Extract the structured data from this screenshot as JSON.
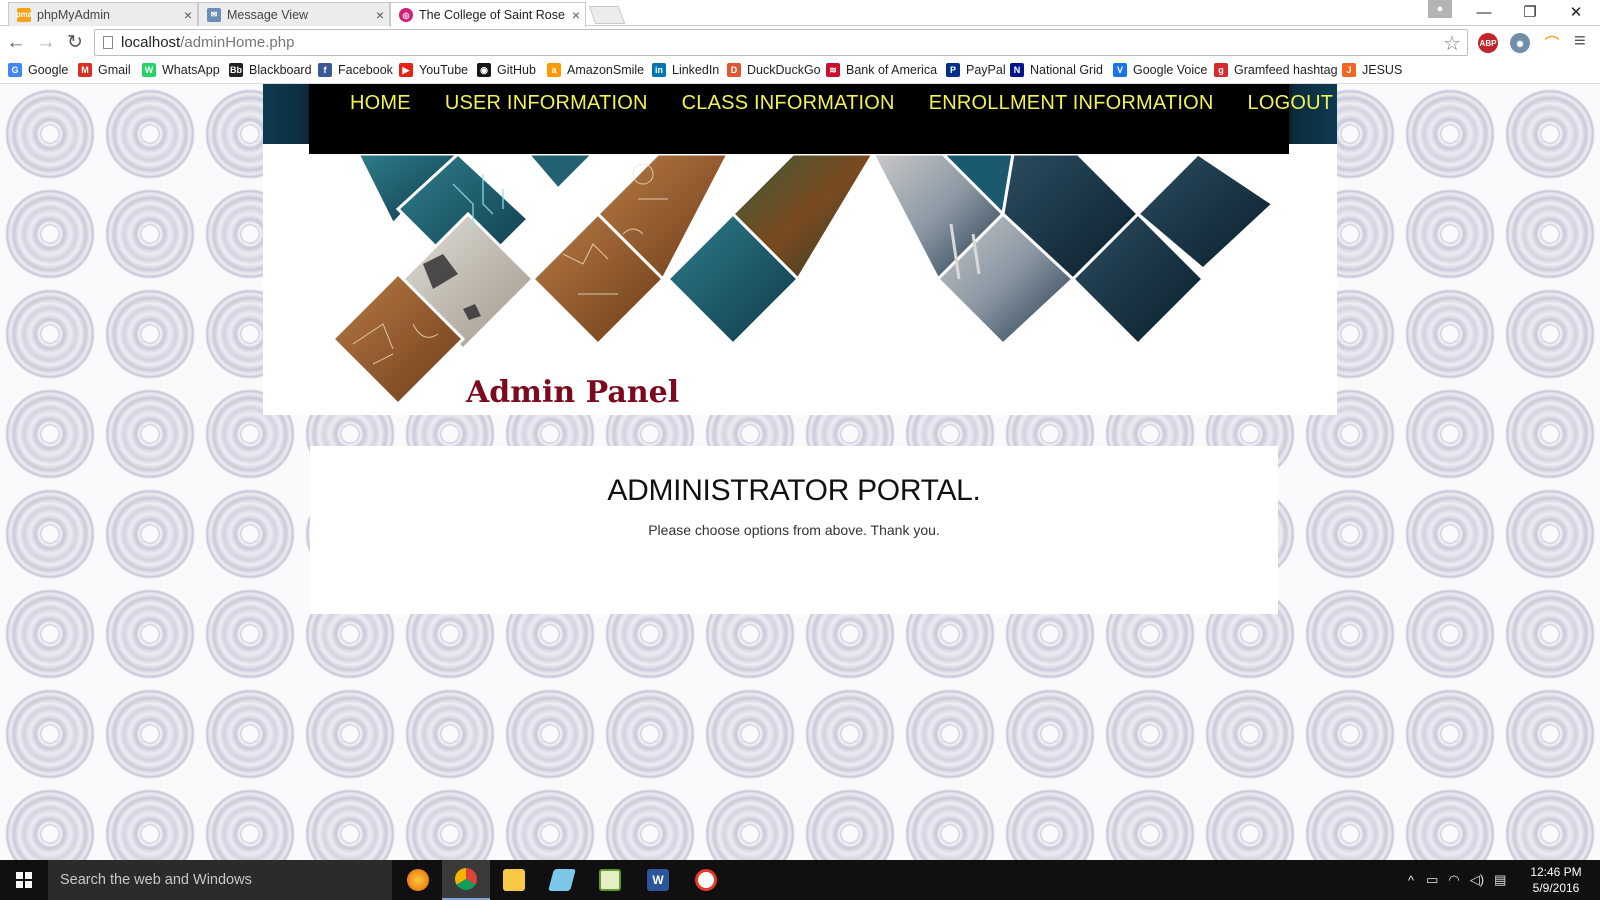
{
  "tabs": [
    {
      "title": "phpMyAdmin",
      "icon": "phpmyadmin-icon",
      "close": "×"
    },
    {
      "title": "Message View",
      "icon": "message-icon",
      "close": "×"
    },
    {
      "title": "The College of Saint Rose",
      "icon": "saint-rose-icon",
      "close": "×"
    }
  ],
  "window_controls": {
    "minimize": "—",
    "restore": "❐",
    "close": "✕"
  },
  "address_bar": {
    "host": "localhost",
    "path": "/adminHome.php"
  },
  "extensions": {
    "abp": "ABP"
  },
  "bookmarks": [
    {
      "label": "Google",
      "icon": "G",
      "color": "#4285f4"
    },
    {
      "label": "Gmail",
      "icon": "M",
      "color": "#d93025"
    },
    {
      "label": "WhatsApp",
      "icon": "W",
      "color": "#25d366"
    },
    {
      "label": "Blackboard",
      "icon": "Bb",
      "color": "#222222"
    },
    {
      "label": "Facebook",
      "icon": "f",
      "color": "#3b5998"
    },
    {
      "label": "YouTube",
      "icon": "▶",
      "color": "#e62117"
    },
    {
      "label": "GitHub",
      "icon": "◉",
      "color": "#181717"
    },
    {
      "label": "AmazonSmile",
      "icon": "a",
      "color": "#ff9900"
    },
    {
      "label": "LinkedIn",
      "icon": "in",
      "color": "#0077b5"
    },
    {
      "label": "DuckDuckGo",
      "icon": "D",
      "color": "#de5833"
    },
    {
      "label": "Bank of America",
      "icon": "≋",
      "color": "#c8102e"
    },
    {
      "label": "PayPal",
      "icon": "P",
      "color": "#003087"
    },
    {
      "label": "National Grid",
      "icon": "N",
      "color": "#00148c"
    },
    {
      "label": "Google Voice",
      "icon": "V",
      "color": "#1a73e8"
    },
    {
      "label": "Gramfeed hashtag",
      "icon": "g",
      "color": "#d62b2b"
    },
    {
      "label": "JESUS",
      "icon": "J",
      "color": "#f26522"
    }
  ],
  "nav": {
    "home": "HOME",
    "user_info": "USER INFORMATION",
    "class_info": "CLASS INFORMATION",
    "enrollment_info": "ENROLLMENT INFORMATION",
    "logout": "LOGOUT"
  },
  "banner": {
    "title": "Admin Panel"
  },
  "portal": {
    "title": "ADMINISTRATOR PORTAL.",
    "message": "Please choose options from above. Thank you."
  },
  "taskbar": {
    "search_placeholder": "Search the web and Windows",
    "time": "12:46 PM",
    "date": "5/9/2016"
  },
  "colors": {
    "nav_text": "#f2f251",
    "admin_title": "#7a0a1c",
    "navbar_bg": "#000000"
  }
}
